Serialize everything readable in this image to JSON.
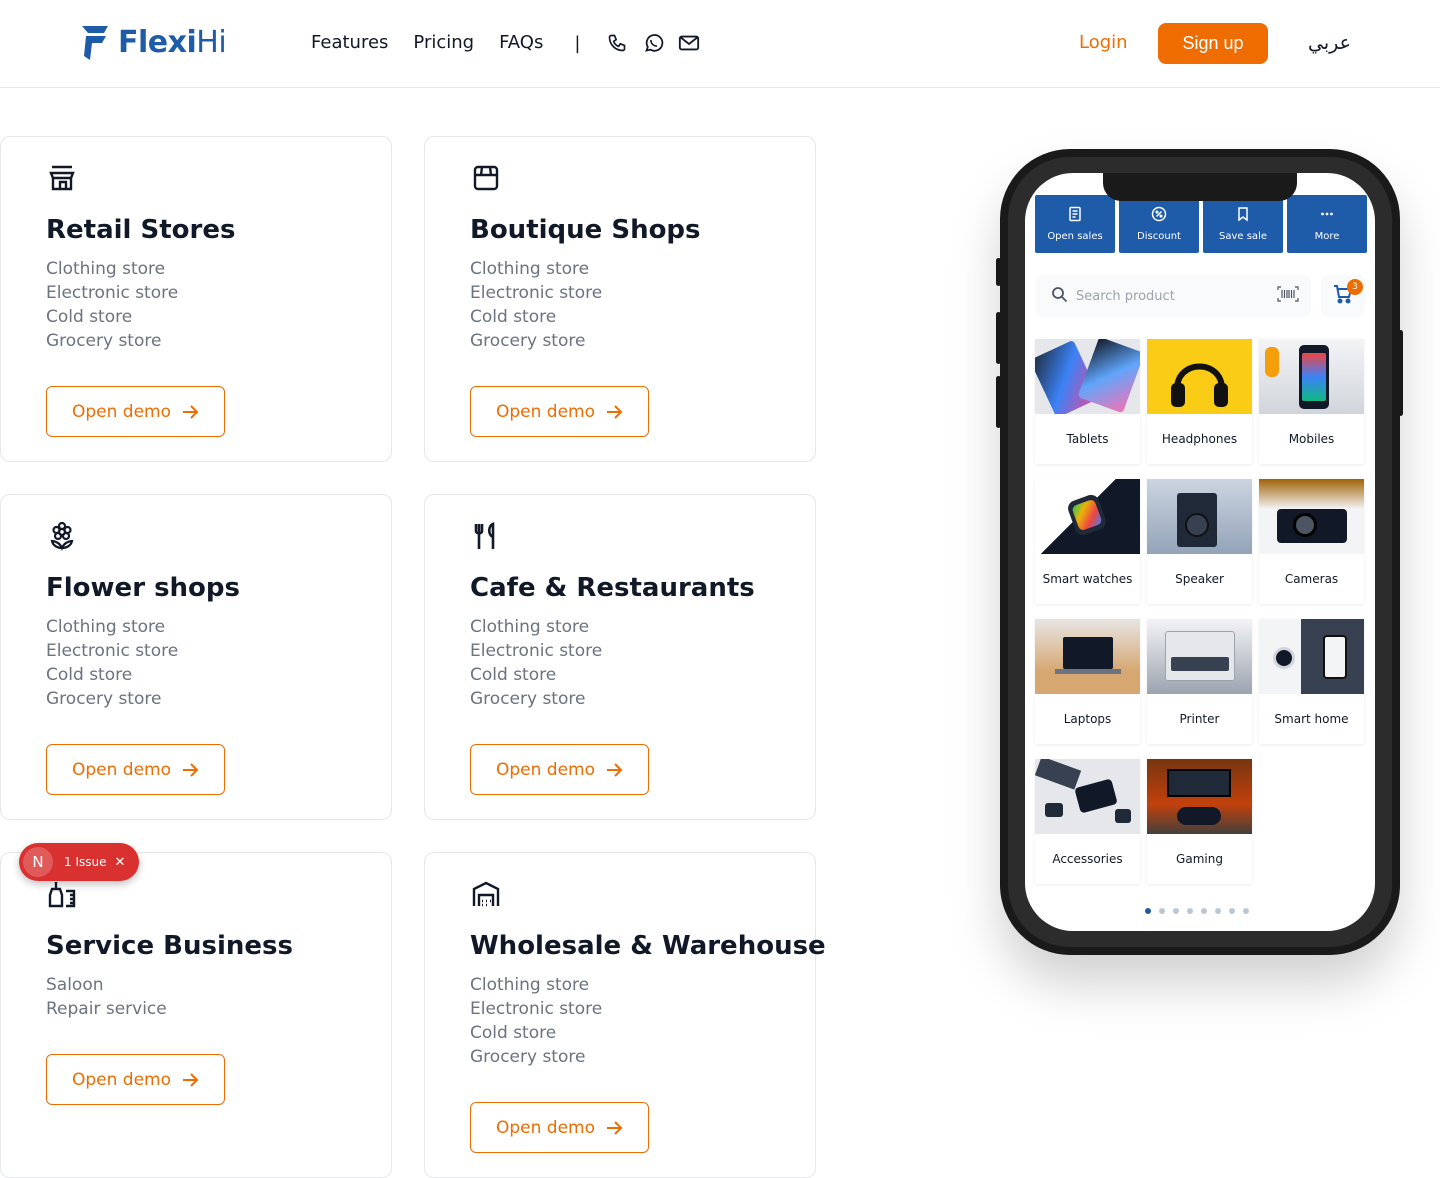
{
  "header": {
    "logo_text_a": "Flexi",
    "logo_text_b": "Hi",
    "nav": [
      "Features",
      "Pricing",
      "FAQs"
    ],
    "separator": "|",
    "contact_icons": [
      "phone-icon",
      "whatsapp-icon",
      "mail-icon"
    ],
    "login": "Login",
    "signup": "Sign up",
    "language": "عربي",
    "brand_color": "#1e5ba8",
    "accent_color": "#ef6c00"
  },
  "cards": [
    {
      "title": "Retail Stores",
      "icon": "store-icon",
      "items": [
        "Clothing store",
        "Electronic store",
        "Cold store",
        "Grocery store"
      ],
      "button": "Open demo"
    },
    {
      "title": "Boutique Shops",
      "icon": "shop-icon",
      "items": [
        "Clothing store",
        "Electronic store",
        "Cold store",
        "Grocery store"
      ],
      "button": "Open demo"
    },
    {
      "title": "Flower shops",
      "icon": "flower-icon",
      "items": [
        "Clothing store",
        "Electronic store",
        "Cold store",
        "Grocery store"
      ],
      "button": "Open demo"
    },
    {
      "title": "Cafe & Restaurants",
      "icon": "fork-knife-icon",
      "items": [
        "Clothing store",
        "Electronic store",
        "Cold store",
        "Grocery store"
      ],
      "button": "Open demo"
    },
    {
      "title": "Service Business",
      "icon": "service-icon",
      "items": [
        "Saloon",
        "Repair service"
      ],
      "button": "Open demo"
    },
    {
      "title": "Wholesale & Warehouse",
      "icon": "warehouse-icon",
      "items": [
        "Clothing store",
        "Electronic store",
        "Cold store",
        "Grocery store"
      ],
      "button": "Open demo"
    }
  ],
  "issue_badge": {
    "letter": "N",
    "text": "1 Issue",
    "close": "✕"
  },
  "phone": {
    "toolbar": [
      "Open sales",
      "Discount",
      "Save sale",
      "More"
    ],
    "search_placeholder": "Search product",
    "cart_count": "3",
    "products": [
      "Tablets",
      "Headphones",
      "Mobiles",
      "Smart watches",
      "Speaker",
      "Cameras",
      "Laptops",
      "Printer",
      "Smart home",
      "Accessories",
      "Gaming"
    ],
    "page_dots": 8,
    "active_dot": 0
  }
}
